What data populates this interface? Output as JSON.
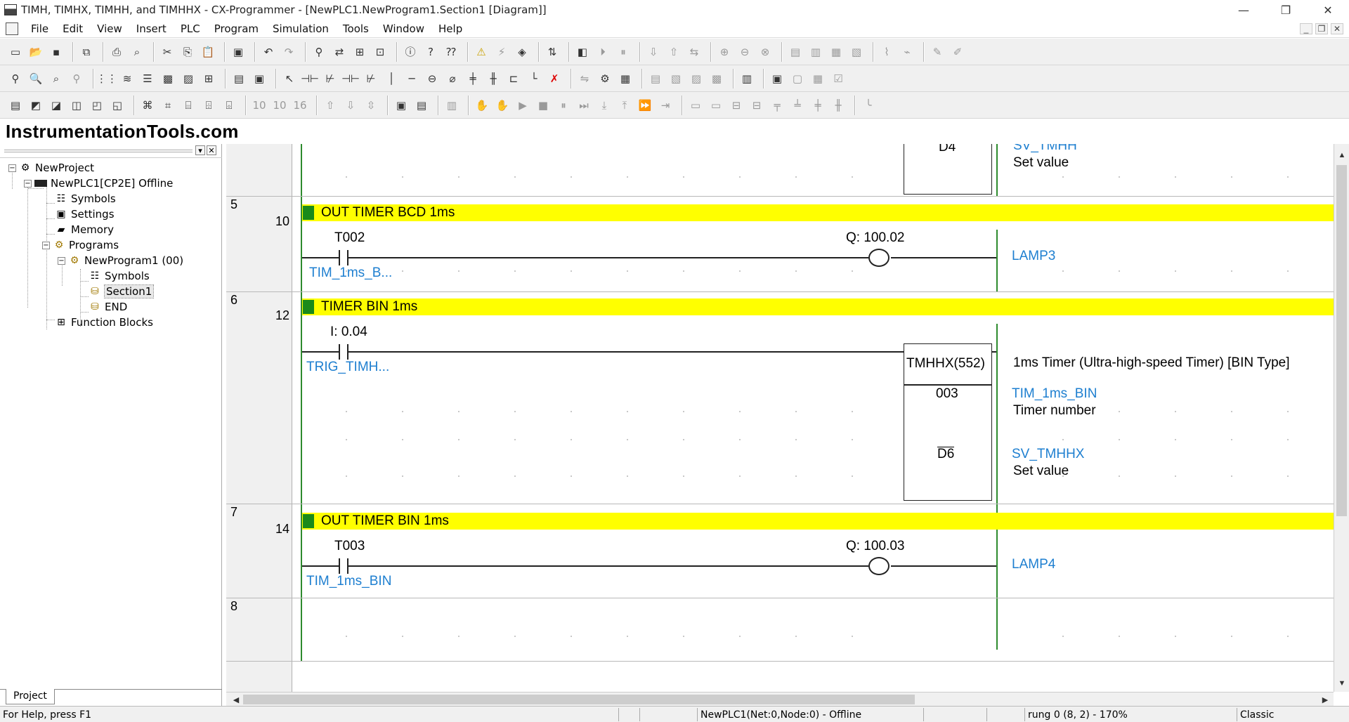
{
  "window": {
    "title": "TIMH, TIMHX, TIMHH, and TIMHHX - CX-Programmer - [NewPLC1.NewProgram1.Section1 [Diagram]]",
    "minimize": "—",
    "restore": "❐",
    "close": "✕"
  },
  "menu": [
    "File",
    "Edit",
    "View",
    "Insert",
    "PLC",
    "Program",
    "Simulation",
    "Tools",
    "Window",
    "Help"
  ],
  "watermark": "InstrumentationTools.com",
  "project_tree": {
    "items": [
      {
        "label": "NewProject",
        "icon": "project-icon"
      },
      {
        "label": "NewPLC1[CP2E] Offline",
        "icon": "plc-icon"
      },
      {
        "label": "Symbols",
        "icon": "symbols-icon"
      },
      {
        "label": "Settings",
        "icon": "settings-icon"
      },
      {
        "label": "Memory",
        "icon": "memory-icon"
      },
      {
        "label": "Programs",
        "icon": "programs-icon"
      },
      {
        "label": "NewProgram1 (00)",
        "icon": "program-icon"
      },
      {
        "label": "Symbols",
        "icon": "symbols-icon"
      },
      {
        "label": "Section1",
        "icon": "section-icon"
      },
      {
        "label": "END",
        "icon": "section-icon"
      },
      {
        "label": "Function Blocks",
        "icon": "function-blocks-icon"
      }
    ],
    "tab": "Project"
  },
  "ladder": {
    "rung4_partial": {
      "operand": "D4",
      "symbol": "SV_TMHH",
      "comment": "Set value"
    },
    "rung5": {
      "rung": "5",
      "step": "10",
      "comment": "OUT TIMER BCD 1ms",
      "contact_addr": "T002",
      "contact_symbol": "TIM_1ms_B...",
      "coil_addr": "Q: 100.02",
      "coil_symbol": "LAMP3"
    },
    "rung6": {
      "rung": "6",
      "step": "12",
      "comment": "TIMER BIN 1ms",
      "contact_addr": "I: 0.04",
      "contact_symbol": "TRIG_TIMH...",
      "instruction": "TMHHX(552)",
      "instruction_desc": "1ms Timer (Ultra-high-speed Timer) [BIN Type]",
      "op1": "003",
      "op1_symbol": "TIM_1ms_BIN",
      "op1_desc": "Timer number",
      "op2": "D6",
      "op2_symbol": "SV_TMHHX",
      "op2_desc": "Set value"
    },
    "rung7": {
      "rung": "7",
      "step": "14",
      "comment": "OUT TIMER BIN 1ms",
      "contact_addr": "T003",
      "contact_symbol": "TIM_1ms_BIN",
      "coil_addr": "Q: 100.03",
      "coil_symbol": "LAMP4"
    },
    "rung8": {
      "rung": "8"
    }
  },
  "status": {
    "help": "For Help, press F1",
    "plc": "NewPLC1(Net:0,Node:0) - Offline",
    "rung": "rung 0 (8, 2)  - 170%",
    "mode": "Classic"
  }
}
